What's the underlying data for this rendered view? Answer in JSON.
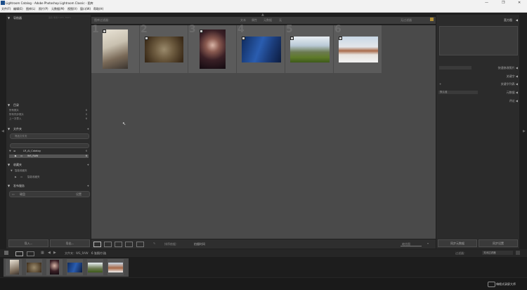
{
  "window": {
    "title": "Lightroom Catalog - Adobe Photoshop Lightroom Classic - 图库",
    "controls": [
      "—",
      "❐",
      "✕"
    ]
  },
  "menu": [
    "文件(F)",
    "编辑(E)",
    "图库(L)",
    "照片(P)",
    "元数据(M)",
    "视图(V)",
    "窗口(W)",
    "帮助(H)"
  ],
  "left_panel": {
    "navigator": {
      "label": "导航器",
      "zoom_options": "适合 填满 100% 300%"
    },
    "catalog": {
      "label": "目录",
      "items": [
        {
          "label": "所有照片",
          "count": "6"
        },
        {
          "label": "所有同步照片",
          "count": "0"
        },
        {
          "label": "上一次导入",
          "count": "6"
        }
      ]
    },
    "folders": {
      "label": "文件夹",
      "search_placeholder": "筛选文件夹",
      "volume": "LR_AI_Catalog",
      "volume_count": "6",
      "folder": "WS_RAW",
      "folder_count": "6"
    },
    "collections": {
      "label": "收藏夹",
      "items": [
        "智能收藏夹",
        "智能收藏夹"
      ]
    },
    "publish": {
      "label": "发布服务",
      "item": "硬盘",
      "action": "设置"
    },
    "import_button": "导入...",
    "export_button": "导出..."
  },
  "filter_bar": {
    "title": "图库过滤器：",
    "options": [
      "文本",
      "属性",
      "元数据",
      "无"
    ],
    "preset": "无过滤器"
  },
  "grid": {
    "thumbnails": [
      {
        "number": "1",
        "name": "man reading"
      },
      {
        "number": "2",
        "name": "cat"
      },
      {
        "number": "3",
        "name": "woman with flower"
      },
      {
        "number": "4",
        "name": "blue abstract"
      },
      {
        "number": "5",
        "name": "green hills"
      },
      {
        "number": "6",
        "name": "animals in snow"
      }
    ]
  },
  "toolbar": {
    "sort_label": "排序依据：",
    "sort_value": "拍摄时间",
    "thumbnails_label": "缩览图"
  },
  "right_panel": {
    "histogram_label": "直方图",
    "quick_develop": "快速修改照片",
    "keywording": "关键字",
    "keyword_list": "关键字列表",
    "metadata": "元数据",
    "metadata_preset": "默认值",
    "comments": "评论",
    "sync_metadata": "同步元数据",
    "sync_settings": "同步设置"
  },
  "filmstrip_bar": {
    "path": "文件夹：WS_RAW",
    "count_text": "6 张照片/选",
    "filter_label": "过滤器：",
    "filter_value": "关闭过滤器"
  },
  "watermark": "嗨格式录屏大师",
  "colors": {
    "brand_icon": "#1c4e8a",
    "panel_bg": "#2b2b2b",
    "grid_bg": "#4a4a4a",
    "cell_bg": "#5b5b5b"
  }
}
